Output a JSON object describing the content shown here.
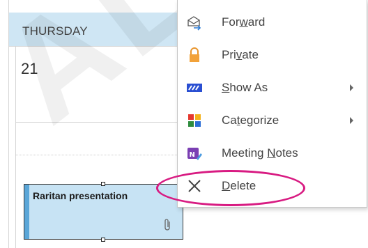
{
  "calendar": {
    "day_name": "THURSDAY",
    "day_number": "21",
    "appointment_title": "Raritan presentation"
  },
  "menu": {
    "items": [
      {
        "icon": "forward-icon",
        "pre": "For",
        "u": "w",
        "post": "ard",
        "submenu": false
      },
      {
        "icon": "lock-icon",
        "pre": "Pri",
        "u": "v",
        "post": "ate",
        "submenu": false
      },
      {
        "icon": "show-as-icon",
        "pre": "",
        "u": "S",
        "post": "how As",
        "submenu": true
      },
      {
        "icon": "categorize-icon",
        "pre": "Ca",
        "u": "t",
        "post": "egorize",
        "submenu": true
      },
      {
        "icon": "onenote-icon",
        "pre": "Meeting ",
        "u": "N",
        "post": "otes",
        "submenu": false
      },
      {
        "icon": "delete-icon",
        "pre": "",
        "u": "D",
        "post": "elete",
        "submenu": false
      }
    ]
  },
  "colors": {
    "header_bg": "#cfe6f4",
    "appointment_bg": "#c7e3f4",
    "appointment_bar": "#5aa6d8",
    "highlight": "#d81b82",
    "lock": "#f2a23a",
    "show_as": "#2a4fd2",
    "onenote": "#7b3fb3"
  }
}
